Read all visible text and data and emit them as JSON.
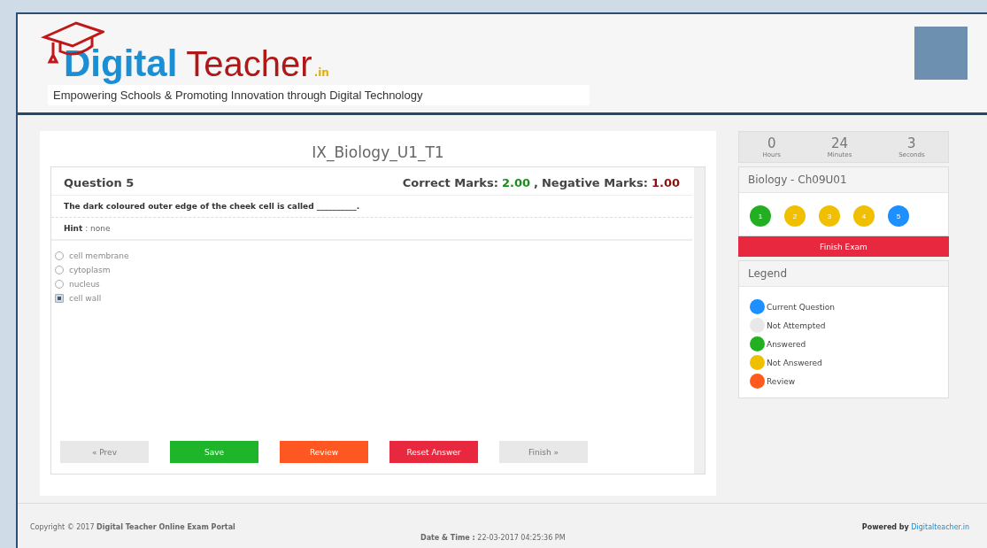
{
  "header": {
    "logo_word_1": "Digital",
    "logo_word_2": "Teacher",
    "logo_suffix": ".in",
    "tagline": "Empowering Schools & Promoting Innovation through Digital Technology"
  },
  "exam": {
    "title": "IX_Biology_U1_T1",
    "question_label": "Question 5",
    "correct_label": "Correct Marks:",
    "correct_value": "2.00",
    "separator": ",",
    "negative_label": "Negative Marks:",
    "negative_value": "1.00",
    "question_text": "The dark coloured outer edge of the cheek cell is called __________.",
    "hint_label": "Hint",
    "hint_value": ": none",
    "options": [
      {
        "label": "cell membrane",
        "selected": false
      },
      {
        "label": "cytoplasm",
        "selected": false
      },
      {
        "label": "nucleus",
        "selected": false
      },
      {
        "label": "cell wall",
        "selected": true
      }
    ],
    "buttons": [
      {
        "label": "« Prev",
        "kind": "plain"
      },
      {
        "label": "Save",
        "kind": "save"
      },
      {
        "label": "Review",
        "kind": "review"
      },
      {
        "label": "Reset Answer",
        "kind": "reset"
      },
      {
        "label": "Finish »",
        "kind": "plain"
      }
    ]
  },
  "timer": [
    {
      "value": "0",
      "unit": "Hours"
    },
    {
      "value": "24",
      "unit": "Minutes"
    },
    {
      "value": "3",
      "unit": "Seconds"
    }
  ],
  "subject": {
    "title": "Biology - Ch09U01",
    "questions": [
      {
        "number": "1",
        "color": "#22b022"
      },
      {
        "number": "2",
        "color": "#f0c000"
      },
      {
        "number": "3",
        "color": "#f0c000"
      },
      {
        "number": "4",
        "color": "#f0c000"
      },
      {
        "number": "5",
        "color": "#1e8fff"
      }
    ],
    "finish_button": "Finish Exam"
  },
  "legend": {
    "title": "Legend",
    "items": [
      {
        "label": "Current Question",
        "color": "#1e8fff"
      },
      {
        "label": "Not Attempted",
        "color": "#e8e8e8"
      },
      {
        "label": "Answered",
        "color": "#22b022"
      },
      {
        "label": "Not Answered",
        "color": "#f0c000"
      },
      {
        "label": "Review",
        "color": "#ff5a1e"
      }
    ]
  },
  "footer": {
    "copyright": "Copyright © 2017 **Digital Teacher Online Exam Portal**",
    "date_label": "Date & Time :",
    "date_value": "22-03-2017 04:25:36 PM",
    "powered_label": "Powered by",
    "powered_link": "Digitalteacher.in"
  }
}
